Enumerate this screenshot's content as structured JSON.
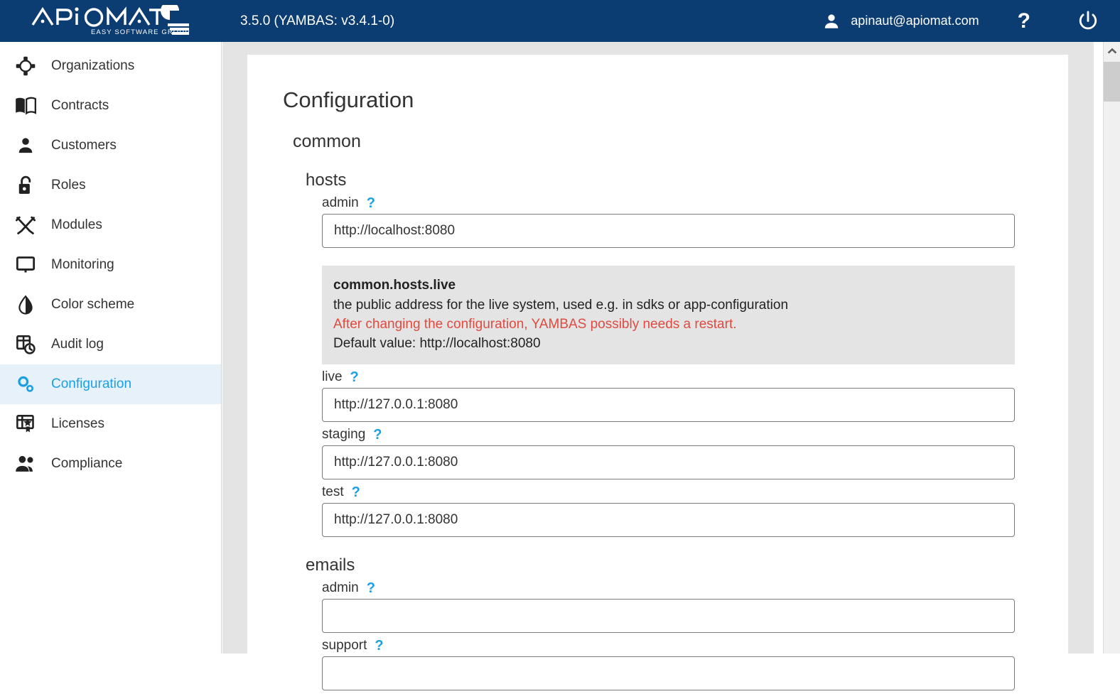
{
  "header": {
    "logo_alt": "APIOMAT",
    "logo_tagline": "EASY SOFTWARE GROUP",
    "version": "3.5.0 (YAMBAS: v3.4.1-0)",
    "user_email": "apinaut@apiomat.com",
    "help_label": "?",
    "brand_color": "#0b3c72"
  },
  "sidebar": {
    "accent_color": "#1b9fe5",
    "active_bg": "#e7f1f9",
    "items": [
      {
        "label": "Organizations",
        "icon": "organizations-icon",
        "active": false
      },
      {
        "label": "Contracts",
        "icon": "book-icon",
        "active": false
      },
      {
        "label": "Customers",
        "icon": "person-icon",
        "active": false
      },
      {
        "label": "Roles",
        "icon": "lock-icon",
        "active": false
      },
      {
        "label": "Modules",
        "icon": "tools-icon",
        "active": false
      },
      {
        "label": "Monitoring",
        "icon": "monitor-icon",
        "active": false
      },
      {
        "label": "Color scheme",
        "icon": "contrast-drop-icon",
        "active": false
      },
      {
        "label": "Audit log",
        "icon": "audit-log-icon",
        "active": false
      },
      {
        "label": "Configuration",
        "icon": "gears-icon",
        "active": true
      },
      {
        "label": "Licenses",
        "icon": "certificate-icon",
        "active": false
      },
      {
        "label": "Compliance",
        "icon": "people-icon",
        "active": false
      }
    ]
  },
  "main": {
    "page_title": "Configuration",
    "group_common": "common",
    "group_hosts": "hosts",
    "group_emails": "emails",
    "help_glyph": "?",
    "fields": {
      "hosts_admin": {
        "label": "admin",
        "value": "http://localhost:8080",
        "placeholder": ""
      },
      "hosts_live": {
        "label": "live",
        "value": "http://127.0.0.1:8080",
        "placeholder": ""
      },
      "hosts_staging": {
        "label": "staging",
        "value": "http://127.0.0.1:8080",
        "placeholder": ""
      },
      "hosts_test": {
        "label": "test",
        "value": "http://127.0.0.1:8080",
        "placeholder": ""
      },
      "emails_admin": {
        "label": "admin",
        "value": "",
        "placeholder": ""
      },
      "emails_support": {
        "label": "support",
        "value": "",
        "placeholder": ""
      }
    },
    "info_box": {
      "key": "common.hosts.live",
      "description": "the public address for the live system, used e.g. in sdks or app-configuration",
      "warning": "After changing the configuration, YAMBAS possibly needs a restart.",
      "default_value": "Default value: http://localhost:8080",
      "warning_color": "#e04a3f",
      "background": "#e4e4e4"
    }
  },
  "scrollbar": {
    "up_arrow": "chevron-up-icon",
    "position_percent": 3
  }
}
